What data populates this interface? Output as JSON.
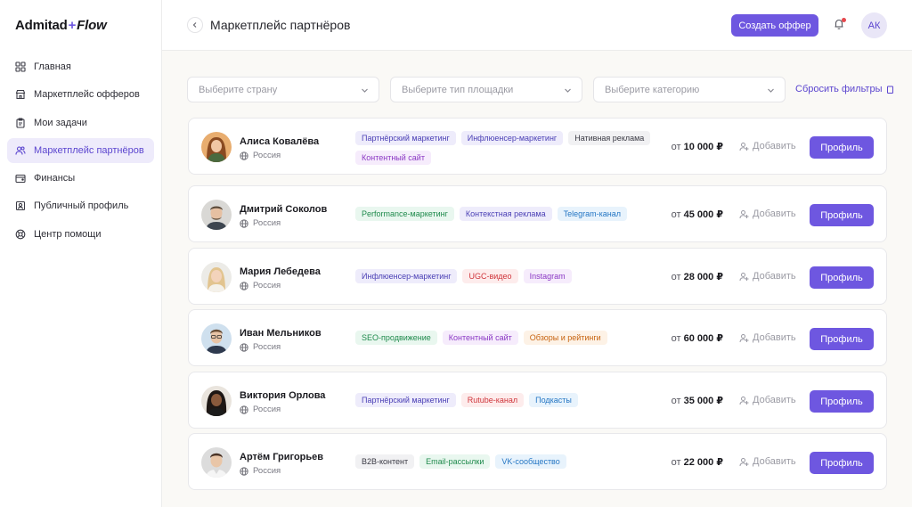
{
  "app": {
    "logo_main": "Admitad",
    "logo_plus": "+",
    "logo_flow": "Flow"
  },
  "sidebar": {
    "items": [
      {
        "label": "Главная",
        "icon": "grid-icon",
        "active": false
      },
      {
        "label": "Маркетплейс офферов",
        "icon": "store-icon",
        "active": false
      },
      {
        "label": "Мои задачи",
        "icon": "clipboard-icon",
        "active": false
      },
      {
        "label": "Маркетплейс партнёров",
        "icon": "users-icon",
        "active": true
      },
      {
        "label": "Финансы",
        "icon": "wallet-icon",
        "active": false
      },
      {
        "label": "Публичный профиль",
        "icon": "profile-card-icon",
        "active": false
      },
      {
        "label": "Центр помощи",
        "icon": "lifebuoy-icon",
        "active": false
      }
    ]
  },
  "header": {
    "title": "Маркетплейс партнёров",
    "create_label": "Создать оффер",
    "avatar_initials": "АК"
  },
  "filters": {
    "country": "Выберите страну",
    "platform": "Выберите тип площадки",
    "category": "Выберите категорию",
    "reset_label": "Сбросить фильтры"
  },
  "labels": {
    "price_prefix": "от",
    "add": "Добавить",
    "profile": "Профиль"
  },
  "colors": {
    "accent": "#6e57e0",
    "accent_soft": "#eeebfb",
    "notification_dot": "#e5484d"
  },
  "partners": [
    {
      "name": "Алиса Ковалёва",
      "country": "Россия",
      "price": "10 000 ₽",
      "tags": [
        {
          "label": "Партнёрский маркетинг",
          "color": "#4a3fb5",
          "bg": "#eeecfb"
        },
        {
          "label": "Инфлюенсер-маркетинг",
          "color": "#4a3fb5",
          "bg": "#eeecfb"
        },
        {
          "label": "Нативная реклама",
          "color": "#3a3a44",
          "bg": "#f1f1f3"
        },
        {
          "label": "Контентный сайт",
          "color": "#8a37c4",
          "bg": "#f6ecfc"
        }
      ]
    },
    {
      "name": "Дмитрий Соколов",
      "country": "Россия",
      "price": "45 000 ₽",
      "tags": [
        {
          "label": "Performance-маркетинг",
          "color": "#1f8a4c",
          "bg": "#e9f7ef"
        },
        {
          "label": "Контекстная реклама",
          "color": "#4a3fb5",
          "bg": "#eeecfb"
        },
        {
          "label": "Telegram-канал",
          "color": "#2476c4",
          "bg": "#e8f3fc"
        }
      ]
    },
    {
      "name": "Мария Лебедева",
      "country": "Россия",
      "price": "28 000 ₽",
      "tags": [
        {
          "label": "Инфлюенсер-маркетинг",
          "color": "#4a3fb5",
          "bg": "#eeecfb"
        },
        {
          "label": "UGC-видео",
          "color": "#d0363c",
          "bg": "#fdecec"
        },
        {
          "label": "Instagram",
          "color": "#8a37c4",
          "bg": "#f6ecfc"
        }
      ]
    },
    {
      "name": "Иван Мельников",
      "country": "Россия",
      "price": "60 000 ₽",
      "tags": [
        {
          "label": "SEO-продвижение",
          "color": "#1f8a4c",
          "bg": "#e9f7ef"
        },
        {
          "label": "Контентный сайт",
          "color": "#8a37c4",
          "bg": "#f6ecfc"
        },
        {
          "label": "Обзоры и рейтинги",
          "color": "#c7630f",
          "bg": "#fdf2e6"
        }
      ]
    },
    {
      "name": "Виктория Орлова",
      "country": "Россия",
      "price": "35 000 ₽",
      "tags": [
        {
          "label": "Партнёрский маркетинг",
          "color": "#4a3fb5",
          "bg": "#eeecfb"
        },
        {
          "label": "Rutube-канал",
          "color": "#d0363c",
          "bg": "#fdecec"
        },
        {
          "label": "Подкасты",
          "color": "#2476c4",
          "bg": "#e8f3fc"
        }
      ]
    },
    {
      "name": "Артём Григорьев",
      "country": "Россия",
      "price": "22 000 ₽",
      "tags": [
        {
          "label": "B2B-контент",
          "color": "#3a3a44",
          "bg": "#f1f1f3"
        },
        {
          "label": "Email-рассылки",
          "color": "#1f8a4c",
          "bg": "#e9f7ef"
        },
        {
          "label": "VK-сообщество",
          "color": "#2476c4",
          "bg": "#e8f3fc"
        }
      ]
    }
  ]
}
